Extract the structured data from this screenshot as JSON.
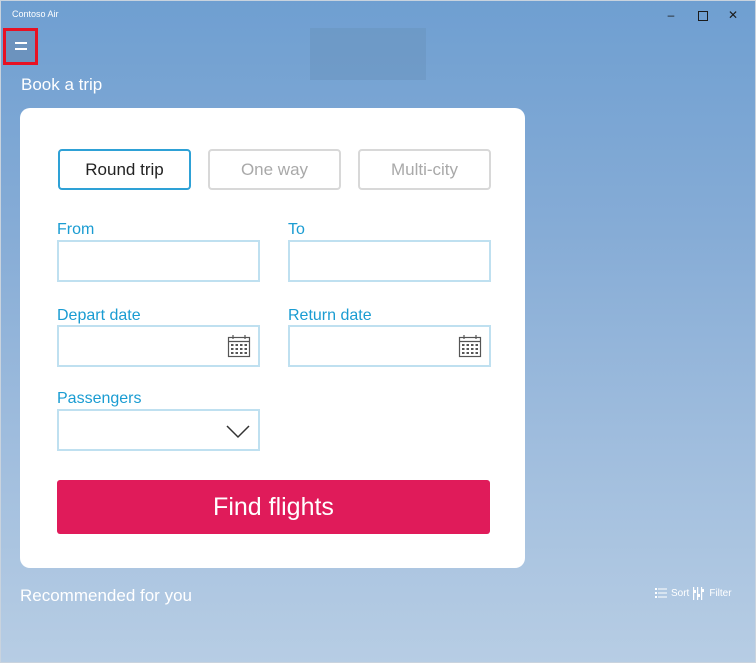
{
  "window": {
    "title": "Contoso Air",
    "minimize_glyph": "–",
    "close_glyph": "✕"
  },
  "nav": {
    "menu_icon": "hamburger-menu-icon"
  },
  "page": {
    "title": "Book a trip"
  },
  "trip_types": [
    {
      "label": "Round trip",
      "selected": true
    },
    {
      "label": "One way",
      "selected": false
    },
    {
      "label": "Multi-city",
      "selected": false
    }
  ],
  "form": {
    "from": {
      "label": "From",
      "value": ""
    },
    "to": {
      "label": "To",
      "value": ""
    },
    "depart": {
      "label": "Depart date",
      "value": "",
      "icon": "calendar-icon"
    },
    "return": {
      "label": "Return date",
      "value": "",
      "icon": "calendar-icon"
    },
    "passengers": {
      "label": "Passengers",
      "value": "",
      "icon": "chevron-down-icon"
    }
  },
  "actions": {
    "find_flights": "Find flights"
  },
  "recommended": {
    "title": "Recommended for you",
    "sort_label": "Sort",
    "filter_label": "Filter"
  },
  "colors": {
    "accent_blue": "#1a9cd2",
    "button_pink": "#e01b5a",
    "highlight_red": "#e81123"
  }
}
